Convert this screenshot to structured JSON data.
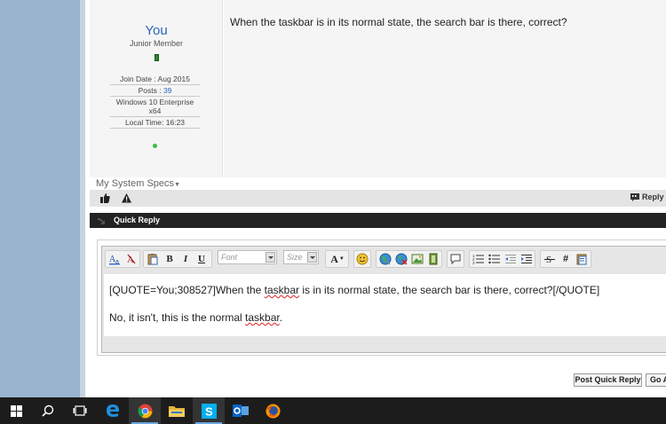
{
  "post": {
    "username": "You",
    "user_title": "Junior Member",
    "stats": [
      {
        "label": "Join Date : Aug 2015",
        "value": ""
      },
      {
        "label": "Posts : ",
        "value": "39"
      },
      {
        "label": "Windows 10 Enterprise x64",
        "value": ""
      },
      {
        "label": "Local Time: 16:23",
        "value": ""
      }
    ],
    "message": "When the taskbar is in its normal state, the search bar is there, correct?",
    "system_specs": "My System Specs",
    "reply_button": "Reply W"
  },
  "quick_reply": {
    "title": "Quick Reply",
    "toolbar": {
      "bold": "B",
      "italic": "I",
      "underline": "U",
      "font_placeholder": "Font",
      "size_placeholder": "Size",
      "font_color": "A"
    },
    "editor": {
      "line1_prefix": "[QUOTE=You;308527]When the ",
      "line1_spell": "taskbar",
      "line1_suffix": " is in its normal state, the search bar is there, correct?[/QUOTE]",
      "line2_prefix": "No, it isn't, this is the normal ",
      "line2_spell": "taskbar",
      "line2_suffix": "."
    },
    "post_button": "Post Quick Reply",
    "advanced_button": "Go A"
  },
  "taskbar": {
    "icons": [
      "windows-start-icon",
      "search-icon",
      "task-view-icon",
      "edge-icon",
      "chrome-icon",
      "file-explorer-icon",
      "skype-icon",
      "outlook-icon",
      "firefox-icon"
    ]
  }
}
